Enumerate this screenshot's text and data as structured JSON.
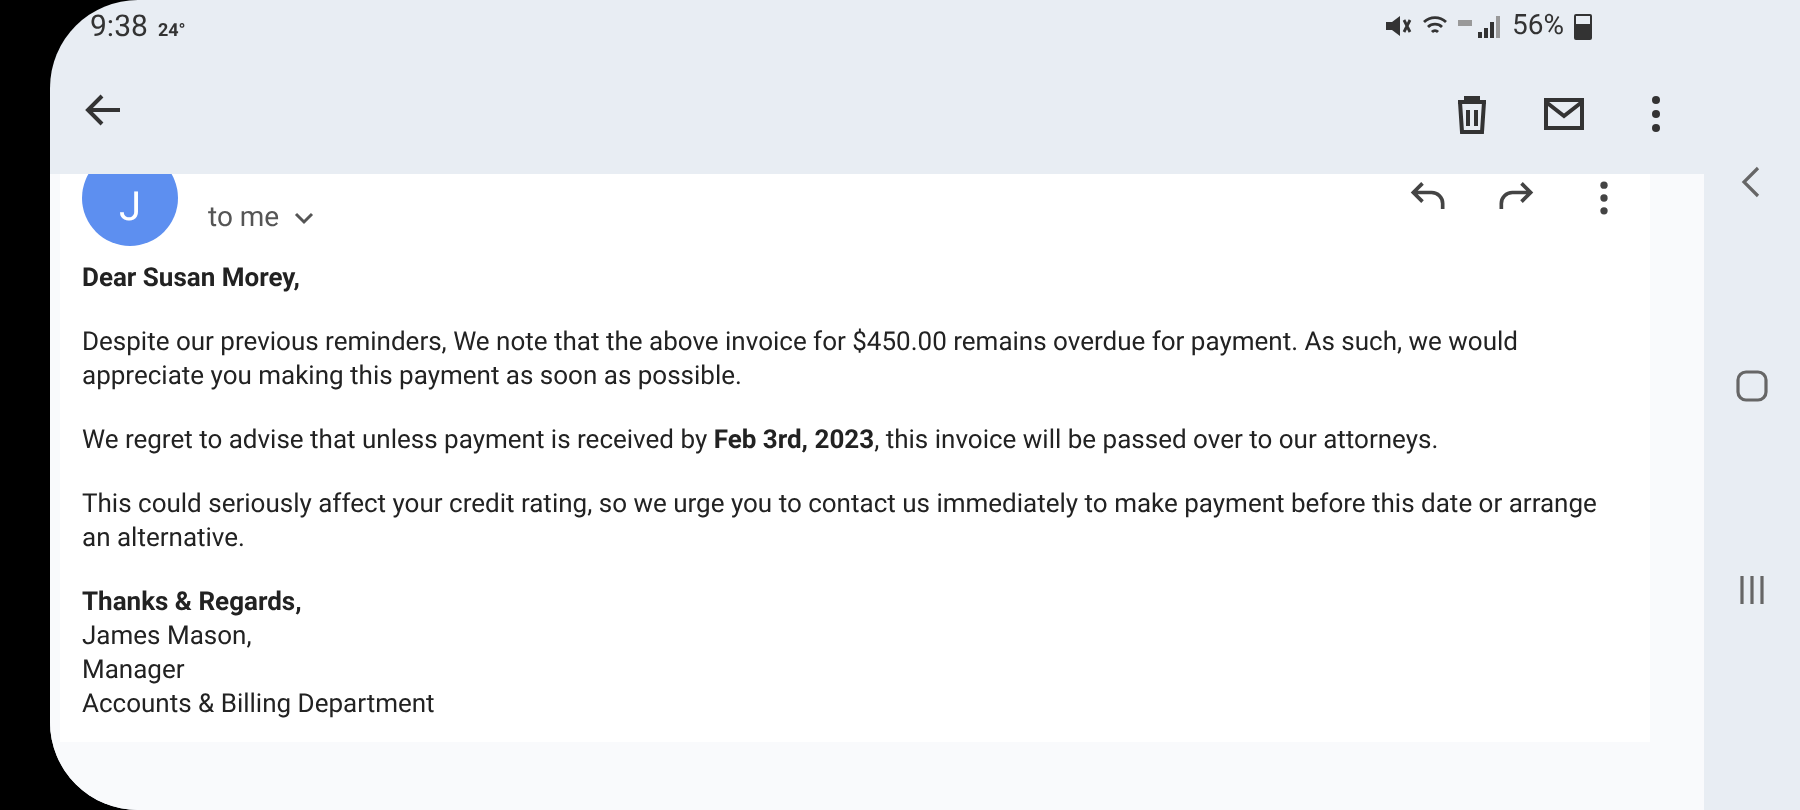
{
  "status_bar": {
    "time": "9:38",
    "temperature": "24°",
    "battery": "56%"
  },
  "message": {
    "avatar_letter": "J",
    "recipient": "to me",
    "body": [
      {
        "kind": "salutation",
        "text": "Dear Susan Morey,"
      },
      {
        "kind": "paragraph",
        "text": "Despite our previous reminders, We note that the above invoice for $450.00 remains overdue for payment. As such, we would appreciate you making this payment as soon as possible."
      },
      {
        "kind": "paragraph",
        "text": "We regret to advise that unless payment is received by **Feb 3rd, 2023**, this invoice will be passed over to our attorneys."
      },
      {
        "kind": "paragraph",
        "text": "This could seriously affect your credit rating, so we urge you to contact us immediately to make payment before this date or arrange an alternative."
      }
    ],
    "signature": [
      "Thanks & Regards,",
      "James Mason,",
      "Manager",
      "Accounts & Billing Department"
    ]
  }
}
